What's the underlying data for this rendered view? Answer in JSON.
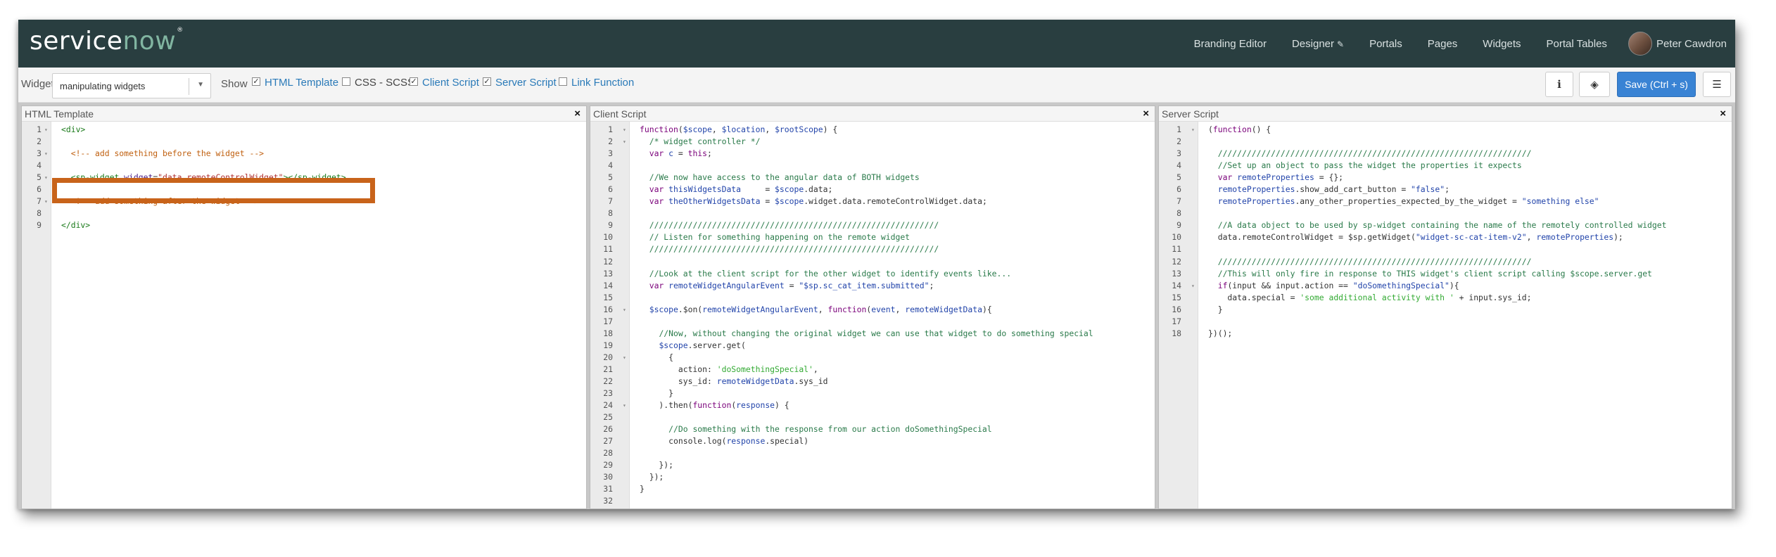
{
  "brand": {
    "part1": "service",
    "part2": "now"
  },
  "nav": {
    "items": [
      "Branding Editor",
      "Designer",
      "Portals",
      "Pages",
      "Widgets",
      "Portal Tables"
    ],
    "designer_icon": "pencil-icon",
    "user_name": "Peter Cawdron"
  },
  "toolbar": {
    "widget_label": "Widget",
    "widget_value": "manipulating widgets",
    "show_label": "Show",
    "options": [
      {
        "label": "HTML Template",
        "checked": true
      },
      {
        "label": "CSS - SCSS",
        "checked": false
      },
      {
        "label": "Client Script",
        "checked": true
      },
      {
        "label": "Server Script",
        "checked": true
      },
      {
        "label": "Link Function",
        "checked": false
      }
    ],
    "info_icon": "info-icon",
    "preview_icon": "eye-slash-icon",
    "save_label": "Save (Ctrl + s)",
    "menu_icon": "hamburger-icon"
  },
  "panes": {
    "html": {
      "title": "HTML Template",
      "close": "×"
    },
    "client": {
      "title": "Client Script",
      "close": "×"
    },
    "server": {
      "title": "Server Script",
      "close": "×"
    }
  },
  "colors": {
    "topbar": "#293e40",
    "brand_accent": "#81b5a1",
    "save": "#3983d4",
    "highlight": "#c8631a"
  }
}
